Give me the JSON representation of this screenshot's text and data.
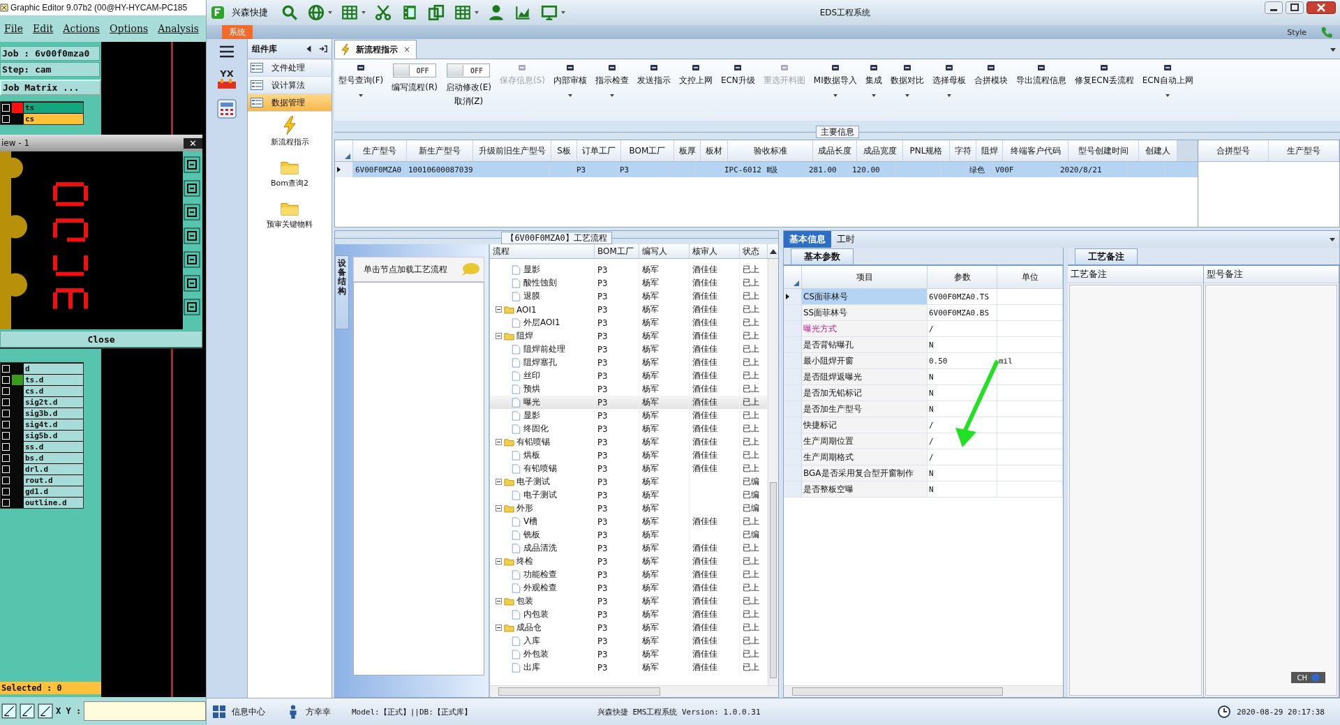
{
  "legacy": {
    "title": "Graphic Editor 9.07b2 (00@HY-HYCAM-PC185",
    "menu": [
      "File",
      "Edit",
      "Actions",
      "Options",
      "Analysis"
    ],
    "job": "Job : 6v00f0mza0",
    "step": "Step: cam",
    "matrix_button": "Job Matrix ...",
    "top_layers": [
      {
        "name": "ts",
        "kind": "work",
        "color": "#ff1010",
        "checked": false
      },
      {
        "name": "cs",
        "kind": "displayed",
        "checked": false
      }
    ],
    "view_window": {
      "title": "iew - 1",
      "close_glyph": "✕",
      "close_button": "Close"
    },
    "layers": [
      {
        "name": "d",
        "checked": false
      },
      {
        "name": "ts.d",
        "color": "#3a9a1a",
        "checked": false
      },
      {
        "name": "cs.d",
        "checked": false
      },
      {
        "name": "sig2t.d",
        "checked": false
      },
      {
        "name": "sig3b.d",
        "checked": false
      },
      {
        "name": "sig4t.d",
        "checked": false
      },
      {
        "name": "sig5b.d",
        "checked": false
      },
      {
        "name": "ss.d",
        "checked": false
      },
      {
        "name": "bs.d",
        "checked": false
      },
      {
        "name": "drl.d",
        "checked": false
      },
      {
        "name": "rout.d",
        "checked": false
      },
      {
        "name": "gd1.d",
        "checked": false
      },
      {
        "name": "outline.d",
        "checked": false
      }
    ],
    "selected_label": "Selected : 0",
    "xy_label": "X Y :"
  },
  "window": {
    "app_name": "兴森快捷",
    "title": "EDS工程系统",
    "system_tab": "系统",
    "style_label": "Style"
  },
  "nav": {
    "header": "组件库",
    "items": [
      {
        "label": "文件处理",
        "selected": false
      },
      {
        "label": "设计算法",
        "selected": false
      },
      {
        "label": "数据管理",
        "selected": true
      }
    ],
    "logo_text": "YX",
    "launchers": [
      {
        "label": "新流程指示",
        "kind": "bolt"
      },
      {
        "label": "Bom查询2",
        "kind": "folder"
      },
      {
        "label": "预审关键物料",
        "kind": "folder"
      }
    ]
  },
  "doc_tab": {
    "label": "新流程指示",
    "close": "×"
  },
  "ribbon": [
    {
      "kind": "button",
      "label": "型号查询(F)",
      "disabled": false,
      "dropdown": true
    },
    {
      "kind": "toggle",
      "label": "编写流程(R)",
      "state_text": "OFF",
      "on": false
    },
    {
      "kind": "toggle",
      "label": "启动修改(E)",
      "sub": "取消(Z)",
      "state_text": "OFF",
      "on": false
    },
    {
      "kind": "button",
      "label": "保存信息(S)",
      "disabled": true,
      "dropdown": false
    },
    {
      "kind": "button",
      "label": "内部审核",
      "disabled": false,
      "dropdown": true
    },
    {
      "kind": "button",
      "label": "指示检查",
      "disabled": false,
      "dropdown": true
    },
    {
      "kind": "button",
      "label": "发送指示",
      "disabled": false,
      "dropdown": false
    },
    {
      "kind": "button",
      "label": "文控上网",
      "disabled": false,
      "dropdown": false
    },
    {
      "kind": "button",
      "label": "ECN升级",
      "disabled": false,
      "dropdown": false
    },
    {
      "kind": "button",
      "label": "重选开料图",
      "disabled": true,
      "dropdown": false
    },
    {
      "kind": "button",
      "label": "MI数据导入",
      "disabled": false,
      "dropdown": true
    },
    {
      "kind": "button",
      "label": "集成",
      "disabled": false,
      "dropdown": true
    },
    {
      "kind": "button",
      "label": "数据对比",
      "disabled": false,
      "dropdown": true
    },
    {
      "kind": "button",
      "label": "选择母板",
      "disabled": false,
      "dropdown": true
    },
    {
      "kind": "button",
      "label": "合拼模块",
      "disabled": false,
      "dropdown": false
    },
    {
      "kind": "button",
      "label": "导出流程信息",
      "disabled": false,
      "dropdown": false
    },
    {
      "kind": "button",
      "label": "修复ECN丢流程",
      "disabled": false,
      "dropdown": false
    },
    {
      "kind": "button",
      "label": "ECN自动上网",
      "disabled": false,
      "dropdown": true
    }
  ],
  "main_info": {
    "title": "主要信息",
    "columns": [
      "生产型号",
      "新生产型号",
      "升级前旧生产型号",
      "S板",
      "订单工厂",
      "BOM工厂",
      "板厚",
      "板材",
      "验收标准",
      "成品长度",
      "成品宽度",
      "PNL规格",
      "字符",
      "阻焊",
      "终端客户代码",
      "型号创建时间",
      "创建人"
    ],
    "rows": [
      {
        "selected": true,
        "cells": [
          "6V00F0MZA0",
          "10010600087039",
          null,
          null,
          "P3",
          "P3",
          null,
          null,
          "IPC-6012 Ⅱ级",
          "281.00",
          "120.00",
          null,
          null,
          "绿色",
          "V00F",
          "2020/8/21",
          null
        ]
      }
    ],
    "side_columns": [
      "合拼型号",
      "生产型号"
    ]
  },
  "process": {
    "title": "【6V00F0MZA0】工艺流程",
    "side_tab": "设备结构",
    "hint": "单击节点加载工艺流程",
    "columns": [
      "流程",
      "BOM工厂",
      "编写人",
      "核审人",
      "状态"
    ],
    "tree": [
      {
        "children": [
          {
            "label": "显影",
            "bom": "P3",
            "writer": "杨军",
            "reviewer": "酒佳佳",
            "status": "已上",
            "selected": false
          },
          {
            "label": "酸性蚀刻",
            "bom": "P3",
            "writer": "杨军",
            "reviewer": "酒佳佳",
            "status": "已上",
            "selected": false
          },
          {
            "label": "退膜",
            "bom": "P3",
            "writer": "杨军",
            "reviewer": "酒佳佳",
            "status": "已上",
            "selected": false
          }
        ]
      },
      {
        "label": "AOI1",
        "bom": "P3",
        "writer": "杨军",
        "reviewer": "酒佳佳",
        "status": "已上",
        "selected": false,
        "children": [
          {
            "label": "外层AOI1",
            "bom": "P3",
            "writer": "杨军",
            "reviewer": "酒佳佳",
            "status": "已上",
            "selected": false
          }
        ]
      },
      {
        "label": "阻焊",
        "bom": "P3",
        "writer": "杨军",
        "reviewer": "酒佳佳",
        "status": "已上",
        "selected": false,
        "children": [
          {
            "label": "阻焊前处理",
            "bom": "P3",
            "writer": "杨军",
            "reviewer": "酒佳佳",
            "status": "已上",
            "selected": false
          },
          {
            "label": "阻焊塞孔",
            "bom": "P3",
            "writer": "杨军",
            "reviewer": "酒佳佳",
            "status": "已上",
            "selected": false
          },
          {
            "label": "丝印",
            "bom": "P3",
            "writer": "杨军",
            "reviewer": "酒佳佳",
            "status": "已上",
            "selected": false
          },
          {
            "label": "预烘",
            "bom": "P3",
            "writer": "杨军",
            "reviewer": "酒佳佳",
            "status": "已上",
            "selected": false
          },
          {
            "label": "曝光",
            "bom": "P3",
            "writer": "杨军",
            "reviewer": "酒佳佳",
            "status": "已上",
            "selected": true
          },
          {
            "label": "显影",
            "bom": "P3",
            "writer": "杨军",
            "reviewer": "酒佳佳",
            "status": "已上",
            "selected": false
          },
          {
            "label": "终固化",
            "bom": "P3",
            "writer": "杨军",
            "reviewer": "酒佳佳",
            "status": "已上",
            "selected": false
          }
        ]
      },
      {
        "label": "有铅喷锡",
        "bom": "P3",
        "writer": "杨军",
        "reviewer": "酒佳佳",
        "status": "已上",
        "selected": false,
        "children": [
          {
            "label": "烘板",
            "bom": "P3",
            "writer": "杨军",
            "reviewer": "酒佳佳",
            "status": "已上",
            "selected": false
          },
          {
            "label": "有铅喷锡",
            "bom": "P3",
            "writer": "杨军",
            "reviewer": "酒佳佳",
            "status": "已上",
            "selected": false
          }
        ]
      },
      {
        "label": "电子测试",
        "bom": "P3",
        "writer": "杨军",
        "status": "已编",
        "selected": false,
        "children": [
          {
            "label": "电子测试",
            "bom": "P3",
            "writer": "杨军",
            "status": "已编",
            "selected": false
          }
        ]
      },
      {
        "label": "外形",
        "bom": "P3",
        "writer": "杨军",
        "status": "已编",
        "selected": false,
        "children": [
          {
            "label": "V槽",
            "bom": "P3",
            "writer": "杨军",
            "reviewer": "酒佳佳",
            "status": "已上",
            "selected": false
          },
          {
            "label": "铣板",
            "bom": "P3",
            "writer": "杨军",
            "status": "已编",
            "selected": false
          },
          {
            "label": "成品清洗",
            "bom": "P3",
            "writer": "杨军",
            "reviewer": "酒佳佳",
            "status": "已上",
            "selected": false
          }
        ]
      },
      {
        "label": "终检",
        "bom": "P3",
        "writer": "杨军",
        "reviewer": "酒佳佳",
        "status": "已上",
        "selected": false,
        "children": [
          {
            "label": "功能检查",
            "bom": "P3",
            "writer": "杨军",
            "reviewer": "酒佳佳",
            "status": "已上",
            "selected": false
          },
          {
            "label": "外观检查",
            "bom": "P3",
            "writer": "杨军",
            "reviewer": "酒佳佳",
            "status": "已上",
            "selected": false
          }
        ]
      },
      {
        "label": "包装",
        "bom": "P3",
        "writer": "杨军",
        "reviewer": "酒佳佳",
        "status": "已上",
        "selected": false,
        "children": [
          {
            "label": "内包装",
            "bom": "P3",
            "writer": "杨军",
            "reviewer": "酒佳佳",
            "status": "已上",
            "selected": false
          }
        ]
      },
      {
        "label": "成品仓",
        "bom": "P3",
        "writer": "杨军",
        "reviewer": "酒佳佳",
        "status": "已上",
        "selected": false,
        "children": [
          {
            "label": "入库",
            "bom": "P3",
            "writer": "杨军",
            "reviewer": "酒佳佳",
            "status": "已上",
            "selected": false
          },
          {
            "label": "外包装",
            "bom": "P3",
            "writer": "杨军",
            "reviewer": "酒佳佳",
            "status": "已上",
            "selected": false
          },
          {
            "label": "出库",
            "bom": "P3",
            "writer": "杨军",
            "reviewer": "酒佳佳",
            "status": "已上",
            "selected": false
          }
        ]
      }
    ]
  },
  "detail": {
    "tabs": [
      {
        "label": "基本信息",
        "selected": true
      },
      {
        "label": "工时",
        "selected": false
      }
    ],
    "param_tab": "基本参数",
    "param_columns": [
      "项目",
      "参数",
      "单位"
    ],
    "params": [
      {
        "item": "CS面菲林号",
        "value": "6V00F0MZA0.TS",
        "highlight": false,
        "selected": true
      },
      {
        "item": "SS面菲林号",
        "value": "6V00F0MZA0.BS",
        "highlight": false,
        "selected": false
      },
      {
        "item": "曝光方式",
        "value": "/",
        "highlight": true,
        "selected": false
      },
      {
        "item": "是否背钻曝孔",
        "value": "N",
        "highlight": false,
        "selected": false
      },
      {
        "item": "最小阻焊开窗",
        "value": "0.50",
        "unit": "mil",
        "highlight": false,
        "selected": false
      },
      {
        "item": "是否阻焊返曝光",
        "value": "N",
        "highlight": false,
        "selected": false
      },
      {
        "item": "是否加无铅标记",
        "value": "N",
        "highlight": false,
        "selected": false
      },
      {
        "item": "是否加生产型号",
        "value": "N",
        "highlight": false,
        "selected": false
      },
      {
        "item": "快捷标记",
        "value": "/",
        "highlight": false,
        "selected": false
      },
      {
        "item": "生产周期位置",
        "value": "/",
        "highlight": false,
        "selected": false
      },
      {
        "item": "生产周期格式",
        "value": "/",
        "highlight": false,
        "selected": false
      },
      {
        "item": "BGA是否采用复合型开窗制作",
        "value": "N",
        "highlight": false,
        "selected": false
      },
      {
        "item": "是否整板空曝",
        "value": "N",
        "highlight": false,
        "selected": false
      }
    ],
    "notes_tab": "工艺备注",
    "notes_columns": [
      "工艺备注",
      "型号备注"
    ],
    "ime": "CH"
  },
  "status_bar": {
    "message_center": "信息中心",
    "user": "方幸幸",
    "model": "Model:【正式】||DB:【正式库】",
    "version": "兴森快捷 EMS工程系统 Version: 1.0.0.31",
    "datetime": "2020-08-29 20:17:38"
  }
}
